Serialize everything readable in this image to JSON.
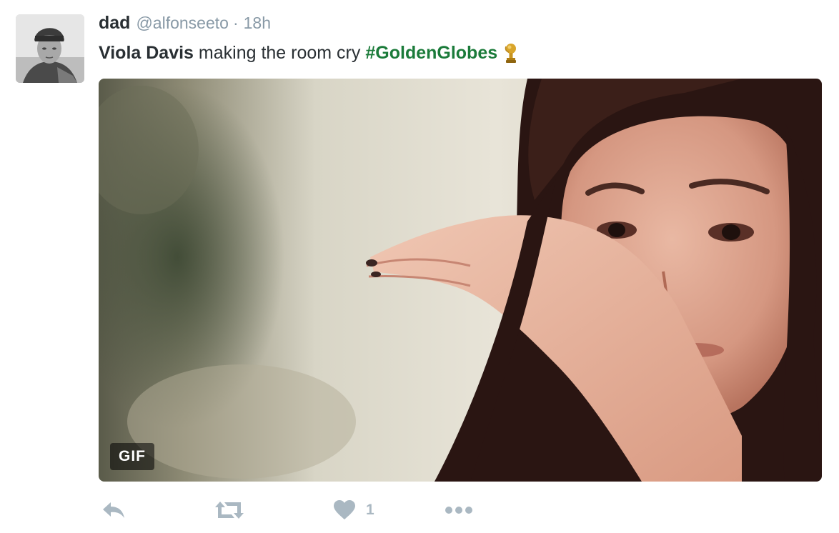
{
  "tweet": {
    "display_name": "dad",
    "screen_name": "@alfonseeto",
    "separator": "·",
    "timestamp": "18h",
    "text": {
      "bold_part": "Viola Davis",
      "plain_part": "making the room cry",
      "hashtag": "#GoldenGlobes"
    },
    "media": {
      "badge": "GIF"
    },
    "actions": {
      "like_count": "1"
    }
  },
  "icons": {
    "reply": "reply-icon",
    "retweet": "retweet-icon",
    "like": "heart-icon",
    "more": "more-icon",
    "trophy": "trophy-icon"
  },
  "colors": {
    "hashtag": "#1b7b3a",
    "muted": "#8899a6",
    "action_gray": "#aab8c2",
    "text": "#292f33"
  }
}
